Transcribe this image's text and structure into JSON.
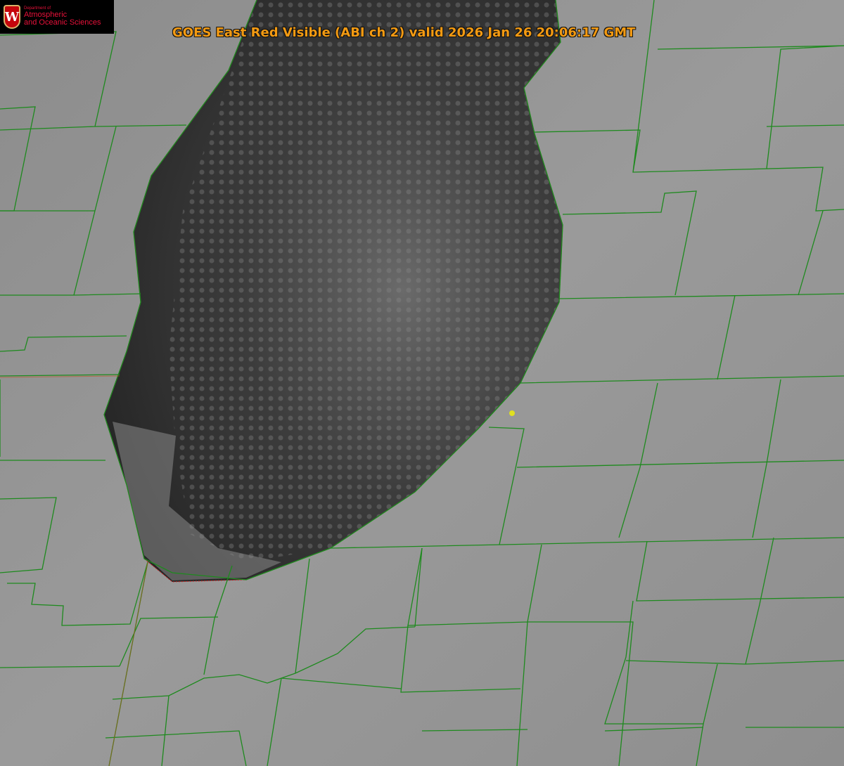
{
  "logo": {
    "department_of": "Department of",
    "line1": "Atmospheric",
    "line2": "and Oceanic Sciences",
    "shield_letter": "W"
  },
  "title": "GOES East Red Visible (ABI ch 2) valid 2026 Jan 26 20:06:17 GMT",
  "colors": {
    "county_lines": "#1e8a1e",
    "shoreline": "#d02020",
    "title_text": "#f39a12",
    "marker": "#e0e020"
  }
}
